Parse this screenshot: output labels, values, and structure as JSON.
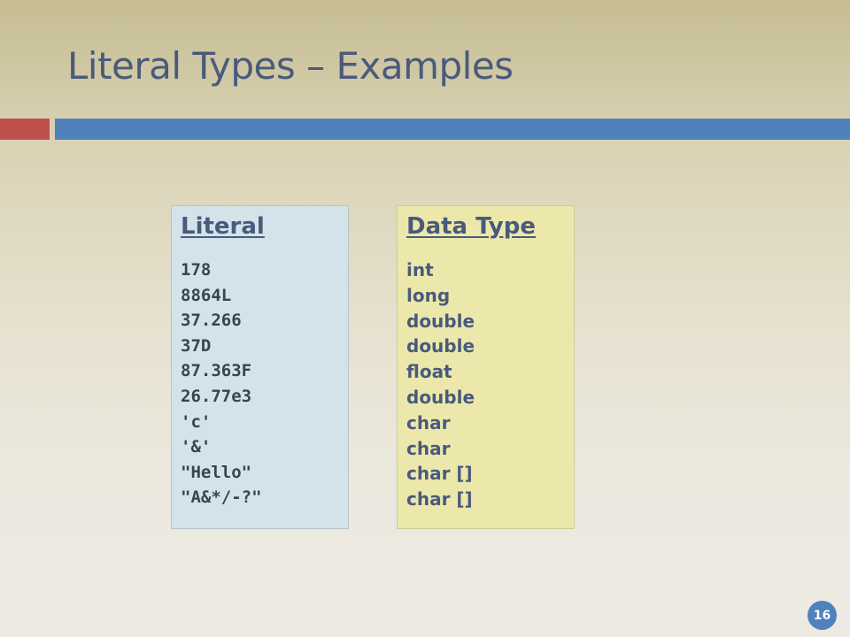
{
  "slide": {
    "title": "Literal Types – Examples",
    "page_number": "16",
    "colors": {
      "title_text": "#4a5a7c",
      "accent_red": "#c0504d",
      "accent_blue": "#4f81bd",
      "literal_box_bg": "#d2e3ea",
      "type_box_bg": "#ece8ab"
    }
  },
  "literal_column": {
    "heading": "Literal",
    "items": [
      "178",
      "8864L",
      "37.266",
      "37D",
      "87.363F",
      "26.77e3",
      "'c'",
      "'&'",
      "\"Hello\"",
      "\"A&*/-?\""
    ]
  },
  "type_column": {
    "heading": "Data Type",
    "items": [
      "int",
      "long",
      "double",
      "double",
      "float",
      "double",
      "char",
      "char",
      "char []",
      "char []"
    ]
  }
}
